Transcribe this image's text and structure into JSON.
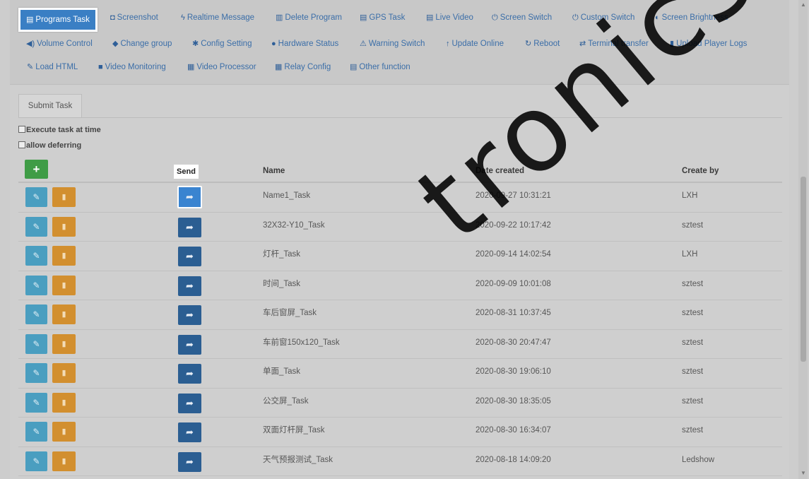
{
  "toolbar": {
    "row1": [
      {
        "icon": "film-icon",
        "glyph": "▤",
        "label": "Programs Task"
      },
      {
        "icon": "camera-icon",
        "glyph": "◘",
        "label": "Screenshot"
      },
      {
        "icon": "bolt-icon",
        "glyph": "ϟ",
        "label": "Realtime Message"
      },
      {
        "icon": "trash-icon",
        "glyph": "▥",
        "label": "Delete Program"
      },
      {
        "icon": "film-icon",
        "glyph": "▤",
        "label": "GPS Task"
      },
      {
        "icon": "film-icon",
        "glyph": "▤",
        "label": "Live Video"
      },
      {
        "icon": "power-icon",
        "glyph": "⏻",
        "label": "Screen Switch"
      },
      {
        "icon": "power-icon",
        "glyph": "⏻",
        "label": "Custom Switch"
      },
      {
        "icon": "contrast-icon",
        "glyph": "◐",
        "label": "Screen Brightness"
      }
    ],
    "row2": [
      {
        "icon": "volume-icon",
        "glyph": "◀)",
        "label": "Volume Control"
      },
      {
        "icon": "tag-icon",
        "glyph": "◆",
        "label": "Change group"
      },
      {
        "icon": "gear-icon",
        "glyph": "✱",
        "label": "Config Setting"
      },
      {
        "icon": "info-icon",
        "glyph": "●",
        "label": "Hardware Status"
      },
      {
        "icon": "warning-icon",
        "glyph": "⚠",
        "label": "Warning Switch"
      },
      {
        "icon": "arrow-up-icon",
        "glyph": "↑",
        "label": "Update Online"
      },
      {
        "icon": "refresh-icon",
        "glyph": "↻",
        "label": "Reboot"
      },
      {
        "icon": "transfer-icon",
        "glyph": "⇄",
        "label": "Terminal transfer"
      },
      {
        "icon": "file-icon",
        "glyph": "▮",
        "label": "Upload Player Logs"
      }
    ],
    "row3": [
      {
        "icon": "pencil-icon",
        "glyph": "✎",
        "label": "Load HTML"
      },
      {
        "icon": "video-icon",
        "glyph": "■",
        "label": "Video Monitoring"
      },
      {
        "icon": "grid-icon",
        "glyph": "▦",
        "label": "Video Processor"
      },
      {
        "icon": "grid-icon",
        "glyph": "▦",
        "label": "Relay Config"
      },
      {
        "icon": "list-icon",
        "glyph": "▤",
        "label": "Other function"
      }
    ]
  },
  "tab": {
    "label": "Submit Task"
  },
  "options": {
    "execute_at_time": "Execute task at time",
    "allow_deferring": "allow deferring"
  },
  "table": {
    "add_glyph": "+",
    "headers": {
      "send": "Send",
      "name": "Name",
      "date": "Date created",
      "create_by": "Create by"
    },
    "rows": [
      {
        "name": "Name1_Task",
        "date": "2020-09-27 10:31:21",
        "by": "LXH"
      },
      {
        "name": "32X32-Y10_Task",
        "date": "2020-09-22 10:17:42",
        "by": "sztest"
      },
      {
        "name": "灯杆_Task",
        "date": "2020-09-14 14:02:54",
        "by": "LXH"
      },
      {
        "name": "时间_Task",
        "date": "2020-09-09 10:01:08",
        "by": "sztest"
      },
      {
        "name": "车后窗屏_Task",
        "date": "2020-08-31 10:37:45",
        "by": "sztest"
      },
      {
        "name": "车前窗150x120_Task",
        "date": "2020-08-30 20:47:47",
        "by": "sztest"
      },
      {
        "name": "单面_Task",
        "date": "2020-08-30 19:06:10",
        "by": "sztest"
      },
      {
        "name": "公交屏_Task",
        "date": "2020-08-30 18:35:05",
        "by": "sztest"
      },
      {
        "name": "双面灯杆屏_Task",
        "date": "2020-08-30 16:34:07",
        "by": "sztest"
      },
      {
        "name": "天气预报测试_Task",
        "date": "2020-08-18 14:09:20",
        "by": "Ledshow"
      }
    ]
  },
  "watermark": "tronics co.,"
}
